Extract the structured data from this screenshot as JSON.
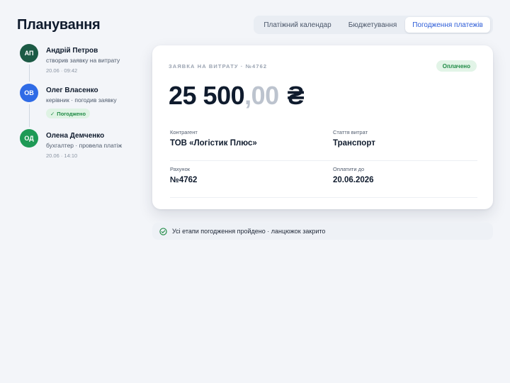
{
  "page": {
    "title": "Планування"
  },
  "tabs": [
    {
      "label": "Платіжний календар",
      "active": false
    },
    {
      "label": "Бюджетування",
      "active": false
    },
    {
      "label": "Погодження платежів",
      "active": true
    }
  ],
  "timeline": [
    {
      "initials": "АП",
      "name": "Андрій Петров",
      "role": "створив заявку на витрату",
      "time": "20.06 · 09:42",
      "color": "#1c5a45"
    },
    {
      "initials": "ОВ",
      "name": "Олег Власенко",
      "role": "керівник · погодив заявку",
      "badge": "Погоджено",
      "color": "#2f6be6"
    },
    {
      "initials": "ОД",
      "name": "Олена Демченко",
      "role": "бухгалтер · провела платіж",
      "time": "20.06 · 14:10",
      "color": "#1e9a56"
    }
  ],
  "request": {
    "overline": "ЗАЯВКА НА ВИТРАТУ · №4762",
    "status": "Оплачено",
    "amount_int": "25 500",
    "amount_frac": ",00",
    "currency": "₴",
    "fields": [
      {
        "label": "Контрагент",
        "value": "ТОВ «Логістик Плюс»"
      },
      {
        "label": "Стаття витрат",
        "value": "Транспорт"
      },
      {
        "label": "Рахунок",
        "value": "№4762"
      },
      {
        "label": "Оплатити до",
        "value": "20.06.2026"
      }
    ]
  },
  "notice": {
    "text": "Усі етапи погодження пройдено · ланцюжок закрито",
    "icon": "check-circle-icon"
  },
  "colors": {
    "accent": "#2b5bd7",
    "success": "#1f8a45",
    "success_bg": "#e2f4e7"
  }
}
